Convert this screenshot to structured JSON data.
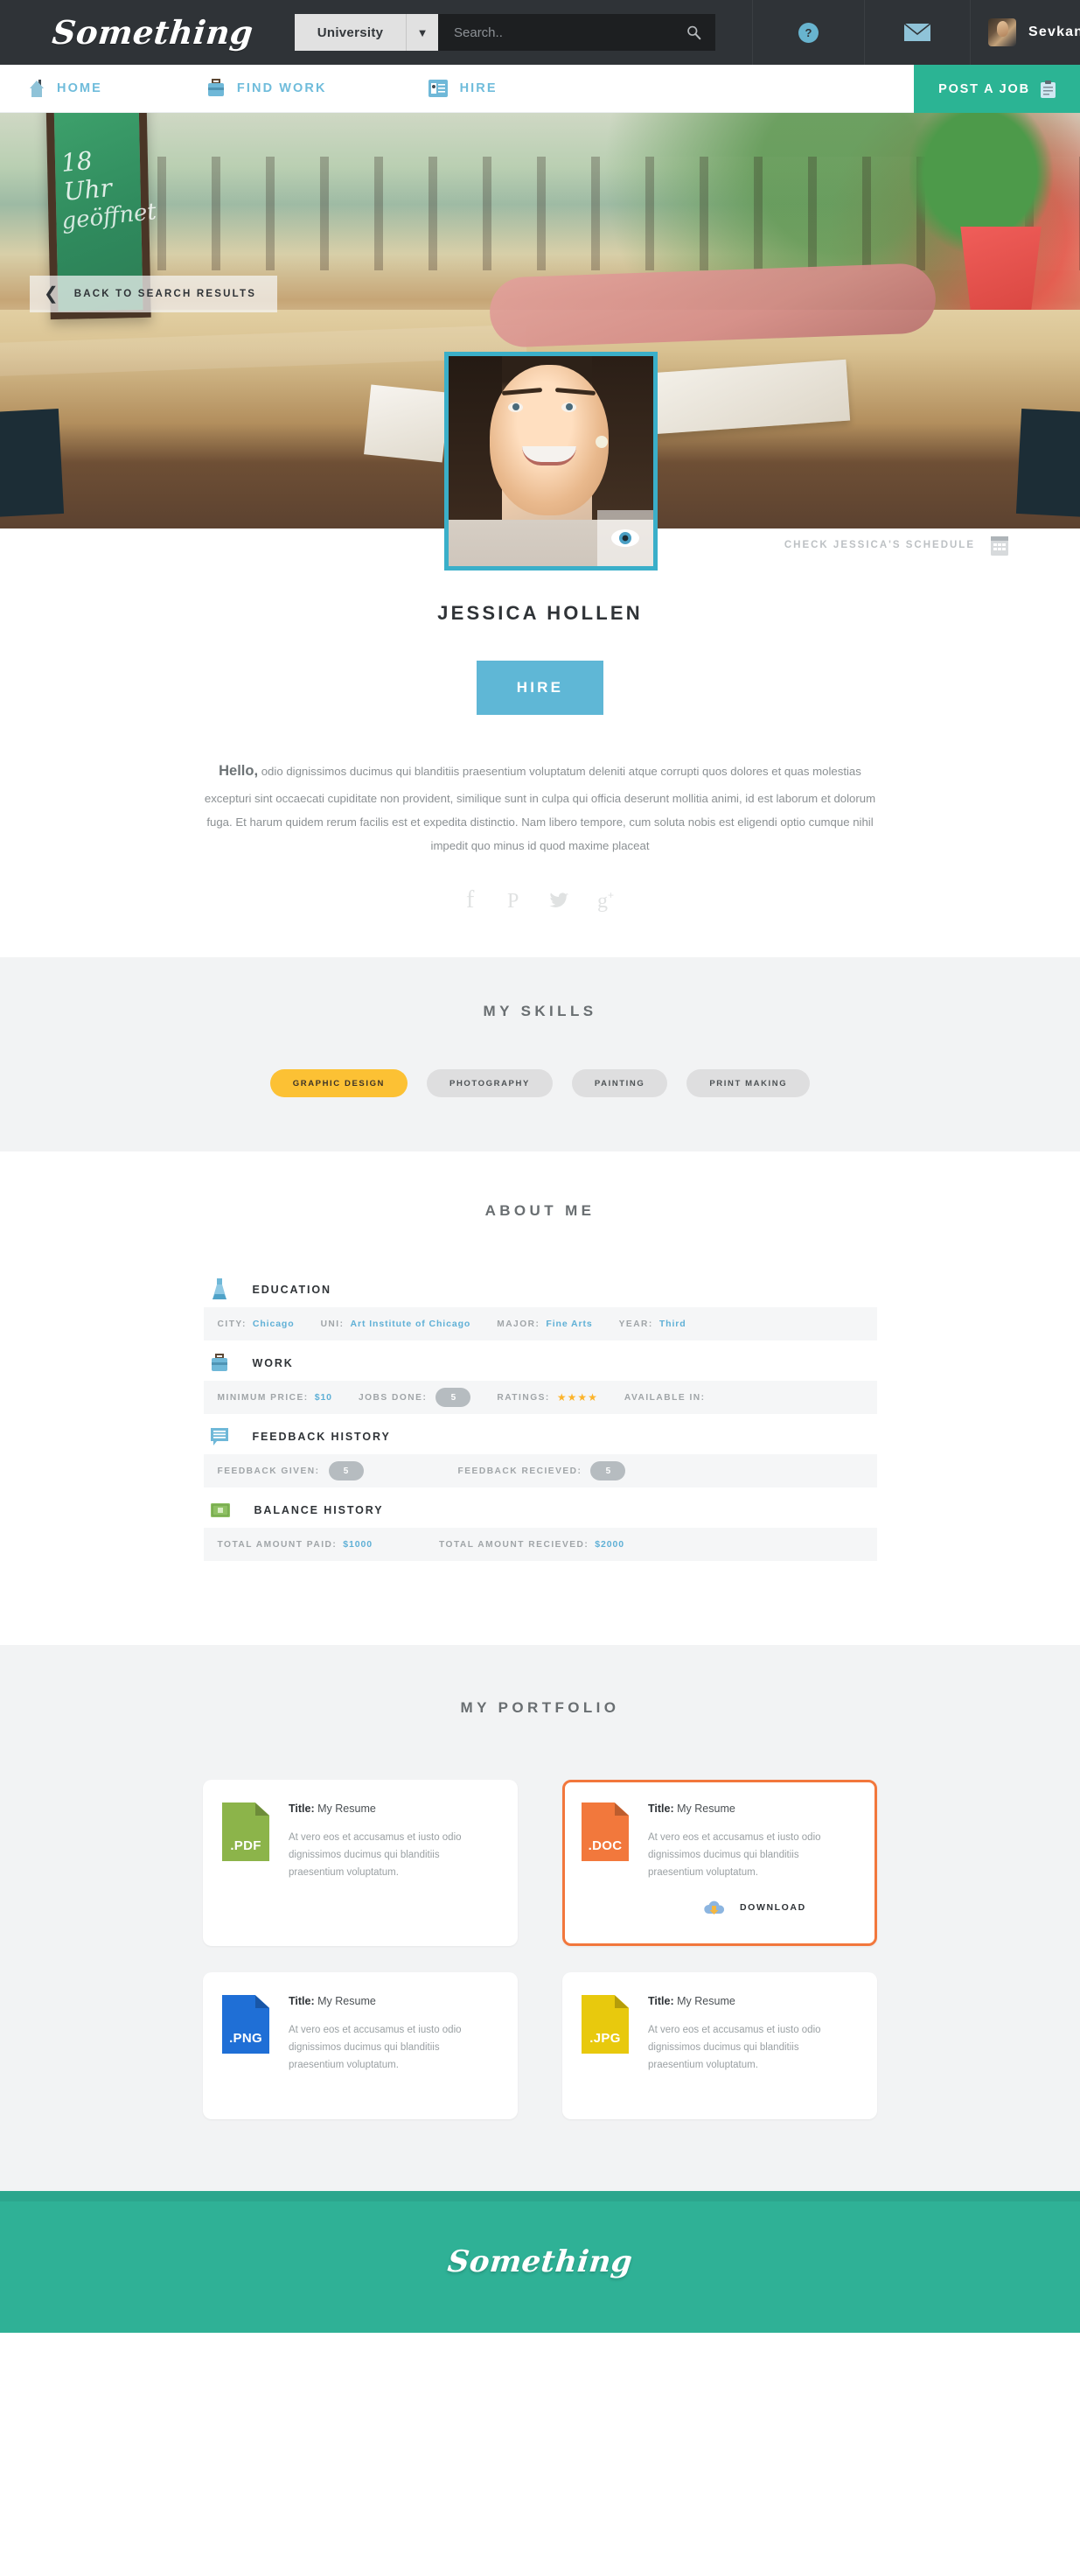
{
  "header": {
    "brand": "Something",
    "search": {
      "category": "University",
      "placeholder": "Search..",
      "caret": "▼",
      "search_icon": "search-icon"
    },
    "help_badge": "?",
    "mail_icon": "envelope-icon",
    "user_name": "Sevkan",
    "user_caret": "▼"
  },
  "nav": {
    "items": [
      {
        "label": "HOME",
        "icon": "home-icon"
      },
      {
        "label": "FIND WORK",
        "icon": "briefcase-icon"
      },
      {
        "label": "HIRE",
        "icon": "id-card-icon"
      }
    ],
    "post_job": {
      "label": "POST A JOB",
      "icon": "clipboard-icon"
    }
  },
  "hero": {
    "back_label": "BACK TO SEARCH RESULTS",
    "back_chevron": "❮",
    "photo_icon": "eye-icon"
  },
  "profile": {
    "schedule_label": "CHECK JESSICA'S SCHEDULE",
    "schedule_icon": "calendar-icon",
    "name": "JESSICA HOLLEN",
    "hire_button": "HIRE",
    "bio_greeting": "Hello,",
    "bio_text": " odio dignissimos ducimus qui blanditiis praesentium voluptatum deleniti atque corrupti quos dolores et quas molestias excepturi sint occaecati cupiditate non provident, similique sunt in culpa qui officia deserunt mollitia animi, id est laborum et dolorum fuga. Et harum quidem rerum facilis est et expedita distinctio. Nam libero tempore, cum soluta nobis est eligendi optio cumque nihil impedit quo minus id quod maxime placeat",
    "socials": [
      {
        "name": "facebook-icon"
      },
      {
        "name": "pinterest-icon"
      },
      {
        "name": "twitter-icon"
      },
      {
        "name": "googleplus-icon"
      }
    ]
  },
  "skills": {
    "title": "MY SKILLS",
    "chips": [
      {
        "label": "GRAPHIC DESIGN",
        "active": true
      },
      {
        "label": "PHOTOGRAPHY",
        "active": false
      },
      {
        "label": "PAINTING",
        "active": false
      },
      {
        "label": "PRINT MAKING",
        "active": false
      }
    ],
    "active_color": "#fcc134"
  },
  "about": {
    "title": "ABOUT ME",
    "education": {
      "heading": "EDUCATION",
      "icon": "flask-icon",
      "fields": [
        {
          "label": "CITY:",
          "value": "Chicago"
        },
        {
          "label": "UNI:",
          "value": "Art Institute of Chicago"
        },
        {
          "label": "MAJOR:",
          "value": "Fine Arts"
        },
        {
          "label": "YEAR:",
          "value": "Third"
        }
      ]
    },
    "work": {
      "heading": "WORK",
      "icon": "briefcase-icon",
      "min_price_label": "MINIMUM PRICE:",
      "min_price_value": "$10",
      "jobs_done_label": "JOBS DONE:",
      "jobs_done_value": "5",
      "ratings_label": "RATINGS:",
      "ratings_stars": "★★★★",
      "available_label": "AVAILABLE IN:"
    },
    "feedback": {
      "heading": "FEEDBACK HISTORY",
      "icon": "chat-list-icon",
      "given_label": "FEEDBACK GIVEN:",
      "given_value": "5",
      "received_label": "FEEDBACK RECIEVED:",
      "received_value": "5"
    },
    "balance": {
      "heading": "BALANCE HISTORY",
      "icon": "money-icon",
      "paid_label": "TOTAL AMOUNT PAID:",
      "paid_value": "$1000",
      "received_label": "TOTAL AMOUNT RECIEVED:",
      "received_value": "$2000"
    }
  },
  "portfolio": {
    "title": "MY PORTFOLIO",
    "download_label": "DOWNLOAD",
    "download_icon": "cloud-download-icon",
    "cards": [
      {
        "ext": ".PDF",
        "color": "#8cb44a",
        "title_label": "Title:",
        "title_value": "My Resume",
        "desc": "At vero eos et accusamus et iusto odio dignissimos ducimus qui blanditiis praesentium voluptatum.",
        "highlighted": false
      },
      {
        "ext": ".DOC",
        "color": "#f2783c",
        "title_label": "Title:",
        "title_value": "My Resume",
        "desc": "At vero eos et accusamus et iusto odio dignissimos ducimus qui blanditiis praesentium voluptatum.",
        "highlighted": true
      },
      {
        "ext": ".PNG",
        "color": "#1f6fd6",
        "title_label": "Title:",
        "title_value": "My Resume",
        "desc": "At vero eos et accusamus et iusto odio dignissimos ducimus qui blanditiis praesentium voluptatum.",
        "highlighted": false
      },
      {
        "ext": ".JPG",
        "color": "#e8c90d",
        "title_label": "Title:",
        "title_value": "My Resume",
        "desc": "At vero eos et accusamus et iusto odio dignissimos ducimus qui blanditiis praesentium voluptatum.",
        "highlighted": false
      }
    ]
  },
  "footer": {
    "brand": "Something",
    "bg_color": "#2fb196"
  }
}
